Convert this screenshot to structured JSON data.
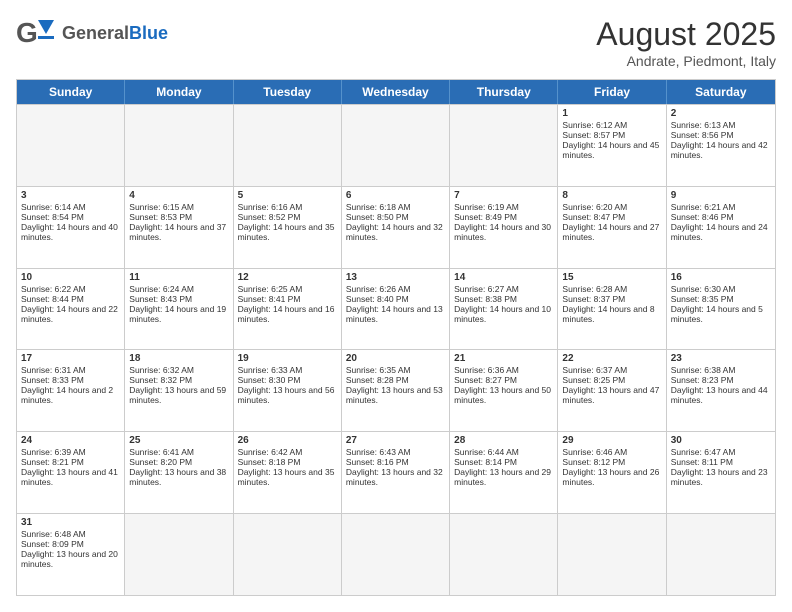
{
  "header": {
    "logo_general": "General",
    "logo_blue": "Blue",
    "title": "August 2025",
    "subtitle": "Andrate, Piedmont, Italy"
  },
  "days_of_week": [
    "Sunday",
    "Monday",
    "Tuesday",
    "Wednesday",
    "Thursday",
    "Friday",
    "Saturday"
  ],
  "weeks": [
    {
      "cells": [
        {
          "day": null,
          "info": ""
        },
        {
          "day": null,
          "info": ""
        },
        {
          "day": null,
          "info": ""
        },
        {
          "day": null,
          "info": ""
        },
        {
          "day": null,
          "info": ""
        },
        {
          "day": "1",
          "info": "Sunrise: 6:12 AM\nSunset: 8:57 PM\nDaylight: 14 hours and 45 minutes."
        },
        {
          "day": "2",
          "info": "Sunrise: 6:13 AM\nSunset: 8:56 PM\nDaylight: 14 hours and 42 minutes."
        }
      ]
    },
    {
      "cells": [
        {
          "day": "3",
          "info": "Sunrise: 6:14 AM\nSunset: 8:54 PM\nDaylight: 14 hours and 40 minutes."
        },
        {
          "day": "4",
          "info": "Sunrise: 6:15 AM\nSunset: 8:53 PM\nDaylight: 14 hours and 37 minutes."
        },
        {
          "day": "5",
          "info": "Sunrise: 6:16 AM\nSunset: 8:52 PM\nDaylight: 14 hours and 35 minutes."
        },
        {
          "day": "6",
          "info": "Sunrise: 6:18 AM\nSunset: 8:50 PM\nDaylight: 14 hours and 32 minutes."
        },
        {
          "day": "7",
          "info": "Sunrise: 6:19 AM\nSunset: 8:49 PM\nDaylight: 14 hours and 30 minutes."
        },
        {
          "day": "8",
          "info": "Sunrise: 6:20 AM\nSunset: 8:47 PM\nDaylight: 14 hours and 27 minutes."
        },
        {
          "day": "9",
          "info": "Sunrise: 6:21 AM\nSunset: 8:46 PM\nDaylight: 14 hours and 24 minutes."
        }
      ]
    },
    {
      "cells": [
        {
          "day": "10",
          "info": "Sunrise: 6:22 AM\nSunset: 8:44 PM\nDaylight: 14 hours and 22 minutes."
        },
        {
          "day": "11",
          "info": "Sunrise: 6:24 AM\nSunset: 8:43 PM\nDaylight: 14 hours and 19 minutes."
        },
        {
          "day": "12",
          "info": "Sunrise: 6:25 AM\nSunset: 8:41 PM\nDaylight: 14 hours and 16 minutes."
        },
        {
          "day": "13",
          "info": "Sunrise: 6:26 AM\nSunset: 8:40 PM\nDaylight: 14 hours and 13 minutes."
        },
        {
          "day": "14",
          "info": "Sunrise: 6:27 AM\nSunset: 8:38 PM\nDaylight: 14 hours and 10 minutes."
        },
        {
          "day": "15",
          "info": "Sunrise: 6:28 AM\nSunset: 8:37 PM\nDaylight: 14 hours and 8 minutes."
        },
        {
          "day": "16",
          "info": "Sunrise: 6:30 AM\nSunset: 8:35 PM\nDaylight: 14 hours and 5 minutes."
        }
      ]
    },
    {
      "cells": [
        {
          "day": "17",
          "info": "Sunrise: 6:31 AM\nSunset: 8:33 PM\nDaylight: 14 hours and 2 minutes."
        },
        {
          "day": "18",
          "info": "Sunrise: 6:32 AM\nSunset: 8:32 PM\nDaylight: 13 hours and 59 minutes."
        },
        {
          "day": "19",
          "info": "Sunrise: 6:33 AM\nSunset: 8:30 PM\nDaylight: 13 hours and 56 minutes."
        },
        {
          "day": "20",
          "info": "Sunrise: 6:35 AM\nSunset: 8:28 PM\nDaylight: 13 hours and 53 minutes."
        },
        {
          "day": "21",
          "info": "Sunrise: 6:36 AM\nSunset: 8:27 PM\nDaylight: 13 hours and 50 minutes."
        },
        {
          "day": "22",
          "info": "Sunrise: 6:37 AM\nSunset: 8:25 PM\nDaylight: 13 hours and 47 minutes."
        },
        {
          "day": "23",
          "info": "Sunrise: 6:38 AM\nSunset: 8:23 PM\nDaylight: 13 hours and 44 minutes."
        }
      ]
    },
    {
      "cells": [
        {
          "day": "24",
          "info": "Sunrise: 6:39 AM\nSunset: 8:21 PM\nDaylight: 13 hours and 41 minutes."
        },
        {
          "day": "25",
          "info": "Sunrise: 6:41 AM\nSunset: 8:20 PM\nDaylight: 13 hours and 38 minutes."
        },
        {
          "day": "26",
          "info": "Sunrise: 6:42 AM\nSunset: 8:18 PM\nDaylight: 13 hours and 35 minutes."
        },
        {
          "day": "27",
          "info": "Sunrise: 6:43 AM\nSunset: 8:16 PM\nDaylight: 13 hours and 32 minutes."
        },
        {
          "day": "28",
          "info": "Sunrise: 6:44 AM\nSunset: 8:14 PM\nDaylight: 13 hours and 29 minutes."
        },
        {
          "day": "29",
          "info": "Sunrise: 6:46 AM\nSunset: 8:12 PM\nDaylight: 13 hours and 26 minutes."
        },
        {
          "day": "30",
          "info": "Sunrise: 6:47 AM\nSunset: 8:11 PM\nDaylight: 13 hours and 23 minutes."
        }
      ]
    },
    {
      "cells": [
        {
          "day": "31",
          "info": "Sunrise: 6:48 AM\nSunset: 8:09 PM\nDaylight: 13 hours and 20 minutes."
        },
        {
          "day": null,
          "info": ""
        },
        {
          "day": null,
          "info": ""
        },
        {
          "day": null,
          "info": ""
        },
        {
          "day": null,
          "info": ""
        },
        {
          "day": null,
          "info": ""
        },
        {
          "day": null,
          "info": ""
        }
      ]
    }
  ]
}
